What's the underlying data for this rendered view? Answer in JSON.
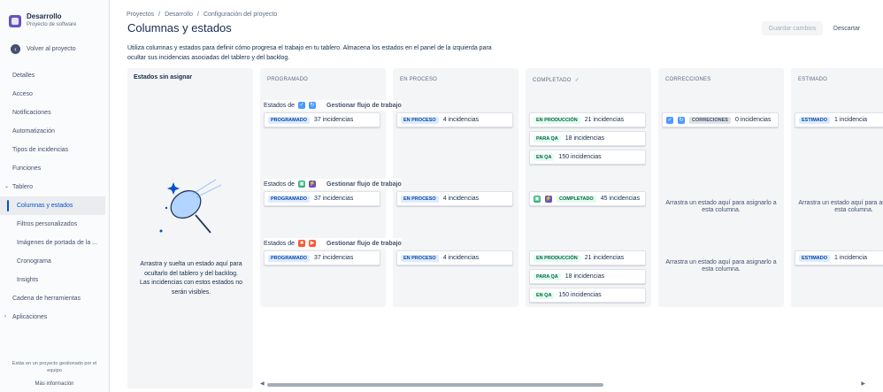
{
  "project": {
    "name": "Desarrollo",
    "subtitle": "Proyecto de software"
  },
  "back_label": "Volver al proyecto",
  "nav": [
    {
      "label": "Detalles",
      "sub": false,
      "active": false
    },
    {
      "label": "Acceso",
      "sub": false,
      "active": false
    },
    {
      "label": "Notificaciones",
      "sub": false,
      "active": false
    },
    {
      "label": "Automatización",
      "sub": false,
      "active": false
    },
    {
      "label": "Tipos de incidencias",
      "sub": false,
      "active": false
    },
    {
      "label": "Funciones",
      "sub": false,
      "active": false
    },
    {
      "label": "Tablero",
      "sub": false,
      "active": false,
      "caret": "⌄"
    },
    {
      "label": "Columnas y estados",
      "sub": true,
      "active": true
    },
    {
      "label": "Filtros personalizados",
      "sub": true,
      "active": false
    },
    {
      "label": "Imágenes de portada de la ...",
      "sub": true,
      "active": false
    },
    {
      "label": "Cronograma",
      "sub": true,
      "active": false
    },
    {
      "label": "Insights",
      "sub": true,
      "active": false
    },
    {
      "label": "Cadena de herramientas",
      "sub": false,
      "active": false
    },
    {
      "label": "Aplicaciones",
      "sub": false,
      "active": false,
      "caret": "›"
    }
  ],
  "footer": {
    "text": "Estás en un proyecto gestionado por el equipo",
    "more": "Más información"
  },
  "breadcrumb": [
    "Proyectos",
    "/",
    "Desarrollo",
    "/",
    "Configuración del proyecto"
  ],
  "page_title": "Columnas y estados",
  "buttons": {
    "save": "Guardar cambios",
    "discard": "Descartar"
  },
  "description": "Utiliza columnas y estados para definir cómo progresa el trabajo en tu tablero. Almacena los estados en el panel de la izquierda para ocultar sus incidencias asociadas del tablero y del backlog.",
  "unassigned": {
    "title": "Estados sin asignar",
    "hint": "Arrastra y suelta un estado aquí para ocultarlo del tablero y del backlog. Las incidencias con estos estados no serán visibles."
  },
  "columns": [
    "PROGRAMADO",
    "EN PROCESO",
    "COMPLETADO",
    "CORRECCIONES",
    "ESTIMADO"
  ],
  "completed_check": "✓",
  "row_prefix": "Estados de",
  "row_action": "Gestionar flujo de trabajo",
  "drop_hint": "Arrastra un estado aquí para asignarlo a esta columna.",
  "rows": [
    {
      "icons": [
        {
          "glyph": "✓",
          "color": "#4c9aff"
        },
        {
          "glyph": "↻",
          "color": "#4c9aff"
        }
      ],
      "cards": [
        [
          {
            "status": "PROGRAMADO",
            "count": "37 incidencias",
            "tone": "blue"
          }
        ],
        [
          {
            "status": "EN PROCESO",
            "count": "4 incidencias",
            "tone": "blue"
          }
        ],
        [
          {
            "status": "EN PRODUCCIÓN",
            "count": "21 incidencias",
            "tone": "green"
          },
          {
            "status": "PARA QA",
            "count": "18 incidencias",
            "tone": "green"
          },
          {
            "status": "EN QA",
            "count": "150 incidencias",
            "tone": "green"
          }
        ],
        [
          {
            "status": "CORRECIONES",
            "count": "0 incidencias",
            "tone": "gray",
            "icons": true
          }
        ],
        [
          {
            "status": "ESTIMADO",
            "count": "1 incidencia",
            "tone": "blue"
          }
        ]
      ]
    },
    {
      "icons": [
        {
          "glyph": "▣",
          "color": "#36b37e"
        },
        {
          "glyph": "⚡",
          "color": "#6554c0"
        }
      ],
      "cards": [
        [
          {
            "status": "PROGRAMADO",
            "count": "37 incidencias",
            "tone": "blue"
          }
        ],
        [
          {
            "status": "EN PROCESO",
            "count": "4 incidencias",
            "tone": "blue"
          }
        ],
        [
          {
            "status": "COMPLETADO",
            "count": "45 incidencias",
            "tone": "green",
            "icons": true
          }
        ],
        [],
        []
      ]
    },
    {
      "icons": [
        {
          "glyph": "■",
          "color": "#ff5630"
        },
        {
          "glyph": "▶",
          "color": "#ff5630"
        }
      ],
      "cards": [
        [
          {
            "status": "PROGRAMADO",
            "count": "37 incidencias",
            "tone": "blue"
          }
        ],
        [
          {
            "status": "EN PROCESO",
            "count": "4 incidencias",
            "tone": "blue"
          }
        ],
        [
          {
            "status": "EN PRODUCCIÓN",
            "count": "21 incidencias",
            "tone": "green"
          },
          {
            "status": "PARA QA",
            "count": "18 incidencias",
            "tone": "green"
          },
          {
            "status": "EN QA",
            "count": "150 incidencias",
            "tone": "green"
          }
        ],
        [],
        [
          {
            "status": "ESTIMADO",
            "count": "1 incidencia",
            "tone": "blue"
          }
        ]
      ]
    }
  ]
}
